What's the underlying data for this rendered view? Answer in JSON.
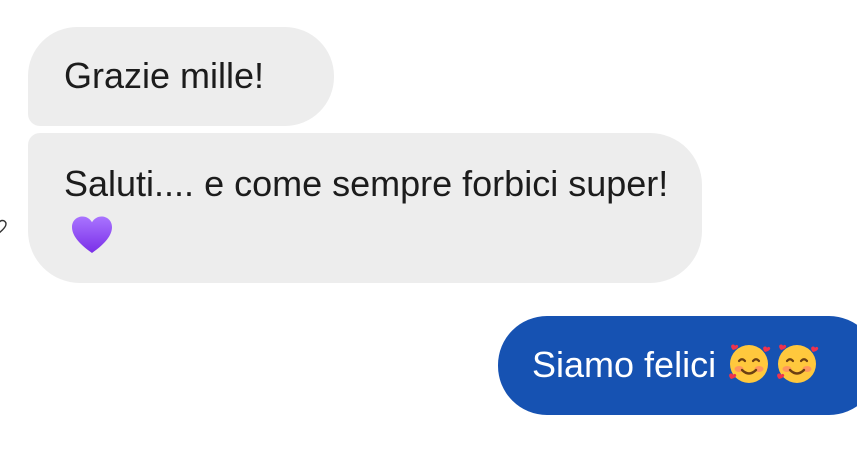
{
  "messages": [
    {
      "direction": "incoming",
      "text": "Grazie mille!"
    },
    {
      "direction": "incoming",
      "text": "Saluti.... e come sempre forbici super!",
      "emoji": "purple-heart"
    },
    {
      "direction": "outgoing",
      "text": "Siamo felici",
      "emoji": [
        "smiling-face-with-hearts",
        "smiling-face-with-hearts"
      ]
    }
  ],
  "colors": {
    "incoming_bubble": "#ededed",
    "outgoing_bubble": "#1652b2",
    "incoming_text": "#1c1c1c",
    "outgoing_text": "#ffffff"
  }
}
